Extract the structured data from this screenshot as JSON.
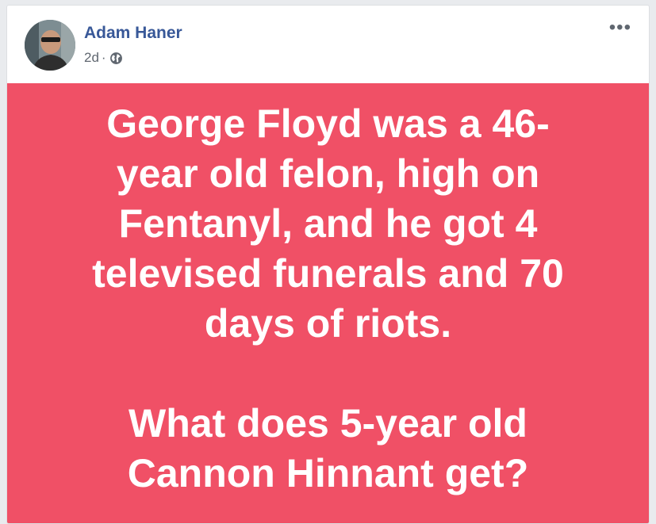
{
  "post": {
    "author": "Adam Haner",
    "time": "2d",
    "separator": "·",
    "more_icon": "•••",
    "privacy_icon": "globe-icon",
    "background_color": "#f05066",
    "paragraphs": [
      {
        "lines": [
          "George Floyd was a 46-",
          "year old felon, high on",
          "Fentanyl, and he got 4",
          "televised funerals and 70",
          "days of riots."
        ]
      },
      {
        "lines": [
          "What does 5-year old",
          "Cannon Hinnant get?"
        ]
      }
    ]
  }
}
